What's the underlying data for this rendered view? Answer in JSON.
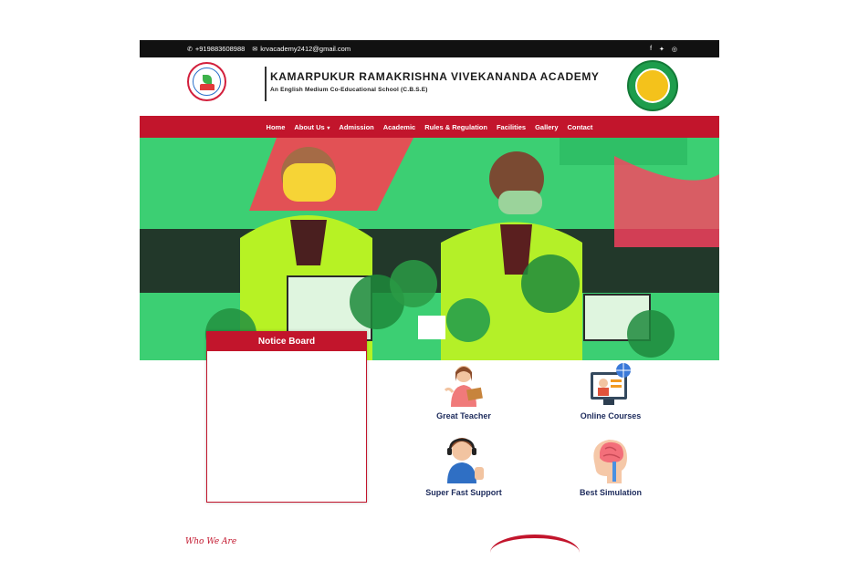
{
  "topbar": {
    "phone": "+919883608988",
    "email": "krvacademy2412@gmail.com",
    "phone_icon": "phone-icon",
    "email_icon": "mail-icon",
    "social": [
      "facebook-icon",
      "twitter-icon",
      "whatsapp-icon"
    ]
  },
  "header": {
    "title": "KAMARPUKUR RAMAKRISHNA VIVEKANANDA ACADEMY",
    "subtitle": "An English Medium Co-Educational School (C.B.S.E)"
  },
  "nav": {
    "items": [
      {
        "label": "Home"
      },
      {
        "label": "About Us"
      },
      {
        "label": "Admission"
      },
      {
        "label": "Academic"
      },
      {
        "label": "Rules & Regulation"
      },
      {
        "label": "Facilities"
      },
      {
        "label": "Gallery"
      },
      {
        "label": "Contact"
      }
    ]
  },
  "notice_board": {
    "title": "Notice Board"
  },
  "features": [
    {
      "label": "Great Teacher",
      "icon": "teacher-icon"
    },
    {
      "label": "Online Courses",
      "icon": "online-courses-icon"
    },
    {
      "label": "Super Fast Support",
      "icon": "support-agent-icon"
    },
    {
      "label": "Best Simulation",
      "icon": "brain-icon"
    }
  ],
  "section": {
    "who_we_are": "Who We Are"
  },
  "colors": {
    "brand_red": "#c2152c",
    "topbar": "#111111",
    "feature_text": "#1d2b5c"
  }
}
